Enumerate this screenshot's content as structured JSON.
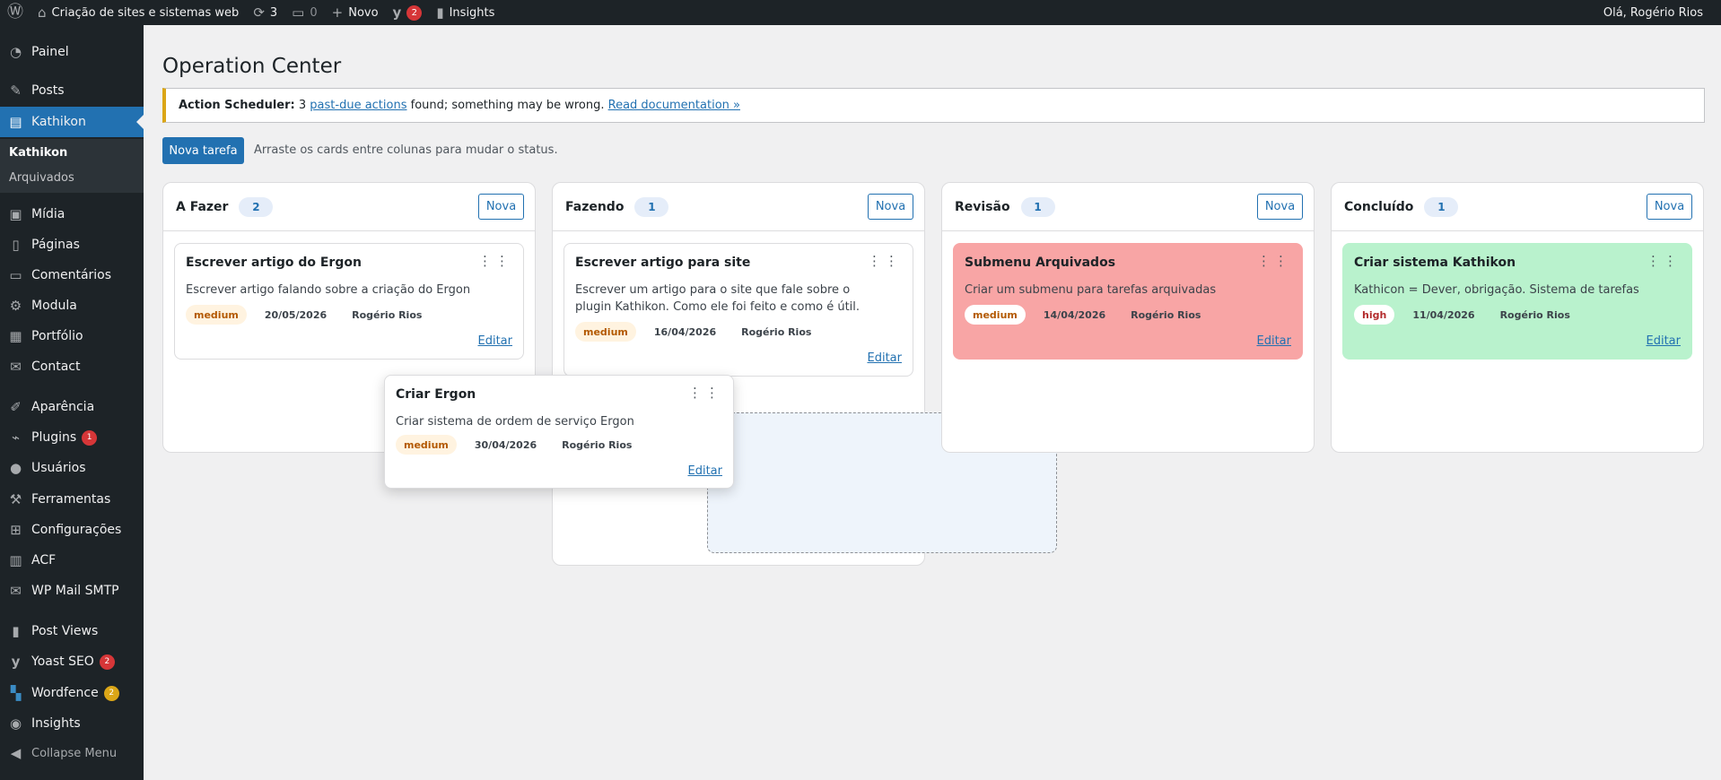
{
  "adminbar": {
    "site_name": "Criação de sites e sistemas web",
    "updates_count": "3",
    "comments_count": "0",
    "new_label": "Novo",
    "yoast_count": "2",
    "insights_label": "Insights",
    "greeting": "Olá, Rogério Rios"
  },
  "sidebar": {
    "items": [
      {
        "label": "Painel",
        "icon": "dashboard-icon"
      },
      {
        "label": "Posts",
        "icon": "pin-icon"
      },
      {
        "label": "Kathikon",
        "icon": "table-icon"
      },
      {
        "label": "Mídia",
        "icon": "media-icon"
      },
      {
        "label": "Páginas",
        "icon": "page-icon"
      },
      {
        "label": "Comentários",
        "icon": "comment-icon"
      },
      {
        "label": "Modula",
        "icon": "gear-icon"
      },
      {
        "label": "Portfólio",
        "icon": "portfolio-icon"
      },
      {
        "label": "Contact",
        "icon": "mail-icon"
      },
      {
        "label": "Aparência",
        "icon": "brush-icon"
      },
      {
        "label": "Plugins",
        "icon": "plugin-icon",
        "badge": "1"
      },
      {
        "label": "Usuários",
        "icon": "user-icon"
      },
      {
        "label": "Ferramentas",
        "icon": "wrench-icon"
      },
      {
        "label": "Configurações",
        "icon": "settings-icon"
      },
      {
        "label": "ACF",
        "icon": "acf-icon"
      },
      {
        "label": "WP Mail SMTP",
        "icon": "mail-icon"
      },
      {
        "label": "Post Views",
        "icon": "chart-icon"
      },
      {
        "label": "Yoast SEO",
        "icon": "yoast-icon",
        "badge": "2"
      },
      {
        "label": "Wordfence",
        "icon": "wordfence-icon",
        "badge": "2"
      },
      {
        "label": "Insights",
        "icon": "insights-icon"
      }
    ],
    "submenu": [
      "Kathikon",
      "Arquivados"
    ],
    "collapse_label": "Collapse Menu"
  },
  "main": {
    "title": "Operation Center",
    "notice": {
      "prefix": "Action Scheduler:",
      "count": "3",
      "link1": "past-due actions",
      "middle": "found; something may be wrong.",
      "link2": "Read documentation »"
    },
    "new_task_button": "Nova tarefa",
    "hint": "Arraste os cards entre colunas para mudar o status.",
    "new_label": "Nova",
    "edit_label": "Editar",
    "columns": [
      {
        "title": "A Fazer",
        "count": "2"
      },
      {
        "title": "Fazendo",
        "count": "1"
      },
      {
        "title": "Revisão",
        "count": "1"
      },
      {
        "title": "Concluído",
        "count": "1"
      }
    ],
    "cards": [
      {
        "title": "Escrever artigo do Ergon",
        "description": "Escrever artigo falando sobre a criação do Ergon",
        "priority": "medium",
        "date": "20/05/2026",
        "owner": "Rogério Rios"
      },
      {
        "title": "Escrever artigo para site",
        "description": "Escrever um artigo para o site que fale sobre o plugin Kathikon. Como ele foi feito e como é útil.",
        "priority": "medium",
        "date": "16/04/2026",
        "owner": "Rogério Rios"
      },
      {
        "title": "Submenu Arquivados",
        "description": "Criar um submenu para tarefas arquivadas",
        "priority": "medium",
        "date": "14/04/2026",
        "owner": "Rogério Rios",
        "color": "#f8a5a5"
      },
      {
        "title": "Criar sistema Kathikon",
        "description": "Kathicon = Dever, obrigação. Sistema de tarefas",
        "priority": "high",
        "date": "11/04/2026",
        "owner": "Rogério Rios",
        "color": "#b9f2cd"
      },
      {
        "title": "Criar Ergon",
        "description": "Criar sistema de ordem de serviço Ergon",
        "priority": "medium",
        "date": "30/04/2026",
        "owner": "Rogério Rios"
      }
    ]
  }
}
